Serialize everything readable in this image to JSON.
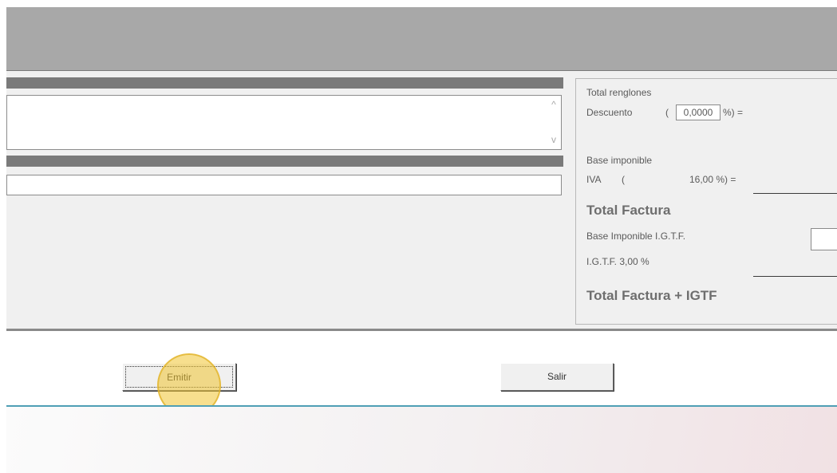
{
  "totals": {
    "total_renglones_label": "Total renglones",
    "descuento_label": "Descuento",
    "descuento_open": "(",
    "descuento_value": "0,0000",
    "descuento_suffix": "%) =",
    "base_imponible_label": "Base imponible",
    "iva_label": "IVA",
    "iva_open": "(",
    "iva_rate": "16,00 %) =",
    "total_factura_label": "Total Factura",
    "base_igtf_label": "Base Imponible I.G.T.F.",
    "igtf_label": "I.G.T.F. 3,00 %",
    "total_factura_igtf_label": "Total Factura + IGTF"
  },
  "buttons": {
    "emitir_label": "Emitir",
    "salir_label": "Salir"
  },
  "icons": {
    "scroll_up": "chevron-up-icon",
    "scroll_down": "chevron-down-icon"
  },
  "colors": {
    "title_bar": "#a8a8a8",
    "form_bg": "#f0f0f0",
    "accent_line": "#4f9fb5",
    "cursor_highlight": "#f0c432"
  }
}
